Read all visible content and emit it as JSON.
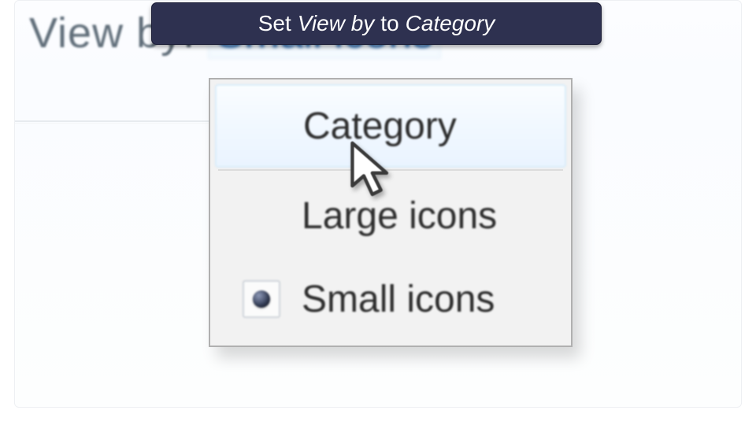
{
  "instruction": {
    "prefix": "Set",
    "field": "View by",
    "middle": "to",
    "value": "Category"
  },
  "viewby": {
    "label": "View by:",
    "current": "Small icons"
  },
  "menu": {
    "items": [
      {
        "label": "Category",
        "selected": false,
        "hover": true
      },
      {
        "label": "Large icons",
        "selected": false,
        "hover": false
      },
      {
        "label": "Small icons",
        "selected": true,
        "hover": false
      }
    ]
  }
}
